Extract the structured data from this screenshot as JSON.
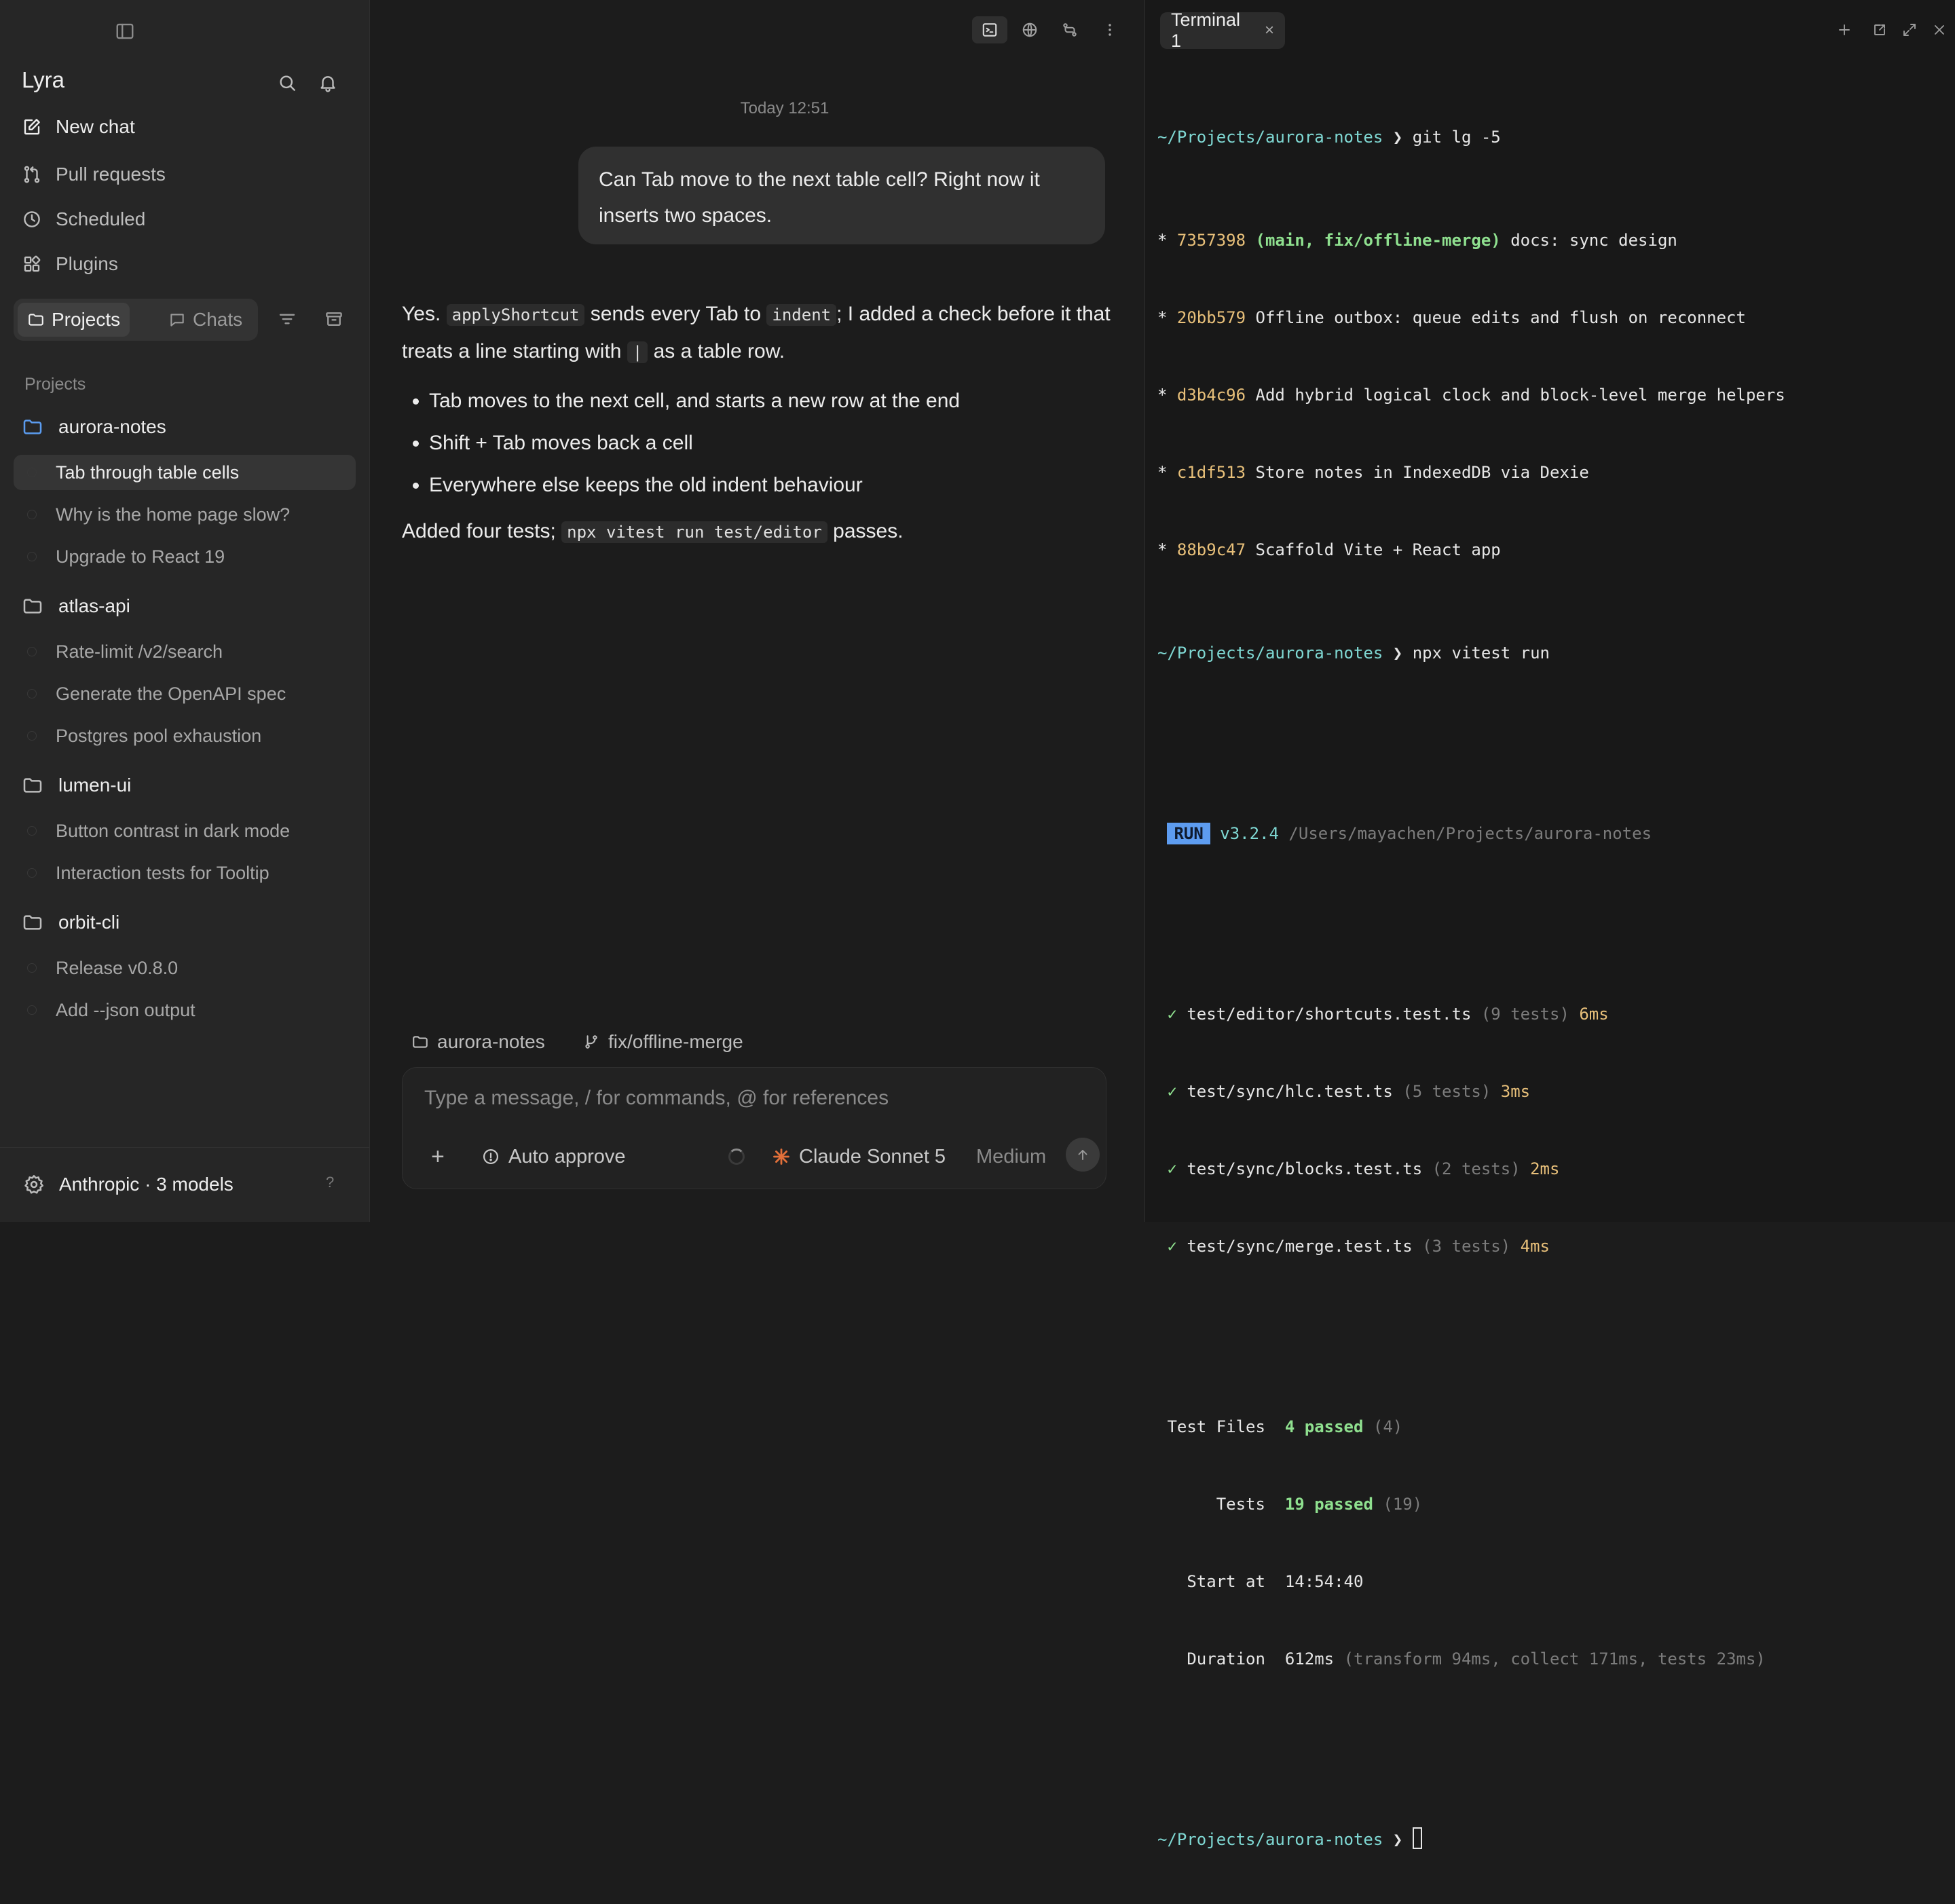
{
  "sidebar": {
    "app_title": "Lyra",
    "nav": [
      {
        "label": "New chat",
        "icon": "edit-icon"
      },
      {
        "label": "Pull requests",
        "icon": "pull-request-icon"
      },
      {
        "label": "Scheduled",
        "icon": "clock-icon"
      },
      {
        "label": "Plugins",
        "icon": "plugins-icon"
      }
    ],
    "segment": {
      "projects": "Projects",
      "chats": "Chats"
    },
    "section_label": "Projects",
    "projects": [
      {
        "name": "aurora-notes",
        "chats": [
          "Tab through table cells",
          "Why is the home page slow?",
          "Upgrade to React 19"
        ]
      },
      {
        "name": "atlas-api",
        "chats": [
          "Rate-limit /v2/search",
          "Generate the OpenAPI spec",
          "Postgres pool exhaustion"
        ]
      },
      {
        "name": "lumen-ui",
        "chats": [
          "Button contrast in dark mode",
          "Interaction tests for Tooltip"
        ]
      },
      {
        "name": "orbit-cli",
        "chats": [
          "Release v0.8.0",
          "Add --json output"
        ]
      }
    ],
    "footer": {
      "text": "Anthropic · 3 models",
      "help": "?"
    }
  },
  "chat": {
    "timestamp": "Today 12:51",
    "user_message": "Can Tab move to the next table cell? Right now it inserts two spaces.",
    "reply": {
      "p1_a": "Yes. ",
      "p1_code1": "applyShortcut",
      "p1_b": " sends every Tab to ",
      "p1_code2": "indent",
      "p1_c": "; I added a check before it that treats a line starting with ",
      "p1_code3": "|",
      "p1_d": " as a table row.",
      "bullets": [
        "Tab moves to the next cell, and starts a new row at the end",
        "Shift + Tab moves back a cell",
        "Everywhere else keeps the old indent behaviour"
      ],
      "p2_a": "Added four tests; ",
      "p2_code": "npx vitest run test/editor",
      "p2_b": " passes."
    },
    "context": {
      "folder": "aurora-notes",
      "branch": "fix/offline-merge"
    },
    "composer": {
      "placeholder": "Type a message, / for commands, @ for references",
      "add": "+",
      "auto_approve": "Auto approve",
      "model": "Claude Sonnet 5",
      "effort": "Medium"
    }
  },
  "terminal": {
    "tab_label": "Terminal 1",
    "tab_close": "×",
    "prompt_path": "~/Projects/aurora-notes",
    "prompt_sym": "❯",
    "cmd1": "git lg -5",
    "commits": [
      {
        "hash": "7357398",
        "refs": "(main, fix/offline-merge)",
        "msg": "docs: sync design"
      },
      {
        "hash": "20bb579",
        "refs": "",
        "msg": "Offline outbox: queue edits and flush on reconnect"
      },
      {
        "hash": "d3b4c96",
        "refs": "",
        "msg": "Add hybrid logical clock and block-level merge helpers"
      },
      {
        "hash": "c1df513",
        "refs": "",
        "msg": "Store notes in IndexedDB via Dexie"
      },
      {
        "hash": "88b9c47",
        "refs": "",
        "msg": "Scaffold Vite + React app"
      }
    ],
    "cmd2": "npx vitest run",
    "run_badge": "RUN",
    "version": "v3.2.4",
    "run_path": "/Users/mayachen/Projects/aurora-notes",
    "tests": [
      {
        "file": "test/editor/shortcuts.test.ts",
        "count": "(9 tests)",
        "time": "6ms"
      },
      {
        "file": "test/sync/hlc.test.ts",
        "count": "(5 tests)",
        "time": "3ms"
      },
      {
        "file": "test/sync/blocks.test.ts",
        "count": "(2 tests)",
        "time": "2ms"
      },
      {
        "file": "test/sync/merge.test.ts",
        "count": "(3 tests)",
        "time": "4ms"
      }
    ],
    "summary": {
      "files_label": "Test Files",
      "files_value": "4 passed",
      "files_total": "(4)",
      "tests_label": "Tests",
      "tests_value": "19 passed",
      "tests_total": "(19)",
      "start_label": "Start at",
      "start_value": "14:54:40",
      "duration_label": "Duration",
      "duration_value": "612ms",
      "duration_detail": "(transform 94ms, collect 171ms, tests 23ms)"
    },
    "check": "✓",
    "star": "*"
  }
}
